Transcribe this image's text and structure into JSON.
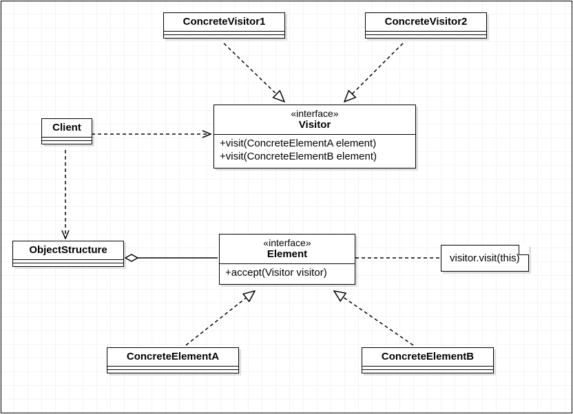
{
  "classes": {
    "cv1": {
      "name": "ConcreteVisitor1"
    },
    "cv2": {
      "name": "ConcreteVisitor2"
    },
    "client": {
      "name": "Client"
    },
    "visitor": {
      "stereotype": "«interface»",
      "name": "Visitor",
      "ops": "+visit(ConcreteElementA element)\n+visit(ConcreteElementB element)"
    },
    "objstruct": {
      "name": "ObjectStructure"
    },
    "element": {
      "stereotype": "«interface»",
      "name": "Element",
      "ops": "+accept(Visitor visitor)"
    },
    "cea": {
      "name": "ConcreteElementA"
    },
    "ceb": {
      "name": "ConcreteElementB"
    },
    "note": {
      "text": "visitor.visit(this)"
    }
  }
}
